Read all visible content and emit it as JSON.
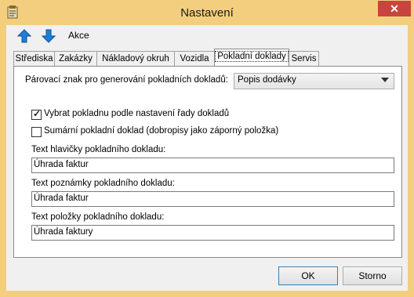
{
  "window": {
    "title": "Nastavení",
    "close_label": "✕"
  },
  "toolbar": {
    "up_icon": "arrow-up-icon",
    "down_icon": "arrow-down-icon",
    "actions_label": "Akce"
  },
  "tabs": [
    {
      "label": "Střediska"
    },
    {
      "label": "Zakázky"
    },
    {
      "label": "Nákladový okruh"
    },
    {
      "label": "Vozidla"
    },
    {
      "label": "Pokladní doklady"
    },
    {
      "label": "Servis"
    }
  ],
  "form": {
    "pairing_label": "Párovací znak pro generování pokladních dokladů:",
    "pairing_value": "Popis dodávky",
    "select_register_label": "Vybrat pokladnu podle nastavení řady dokladů",
    "select_register_checked": true,
    "summary_label": "Sumární pokladní doklad (dobropisy jako záporný položka)",
    "summary_checked": false,
    "header_text_label": "Text hlavičky pokladního dokladu:",
    "header_text_value": "Úhrada faktur",
    "note_text_label": "Text poznámky pokladního dokladu:",
    "note_text_value": "Úhrada faktur",
    "item_text_label": "Text položky pokladního dokladu:",
    "item_text_value": "Úhrada faktury"
  },
  "buttons": {
    "ok_label": "OK",
    "cancel_label": "Storno"
  },
  "colors": {
    "title_bar": "#f3ce7e",
    "close": "#c7453e",
    "accent_arrow": "#1e7fd8"
  }
}
